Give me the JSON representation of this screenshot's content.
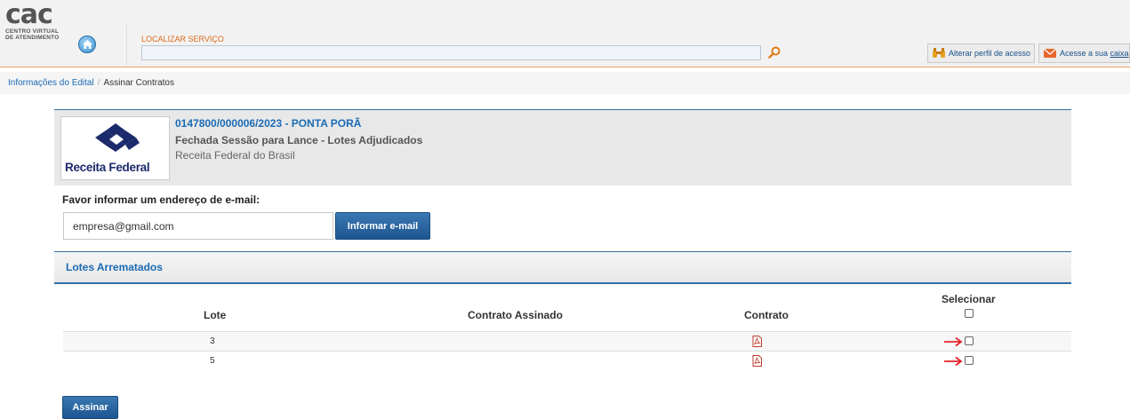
{
  "header": {
    "logo_main": "cac",
    "logo_sub_line1": "CENTRO VIRTUAL",
    "logo_sub_line2": "DE ATENDIMENTO",
    "search_label": "LOCALIZAR SERVIÇO",
    "search_value": "",
    "btn_alterar_perfil": "Alterar perfil de acesso",
    "btn_caixa_prefix": "Acesse a sua",
    "btn_caixa_link": "caixa"
  },
  "breadcrumb": {
    "items": [
      "Informações do Edital",
      "Assinar Contratos"
    ],
    "separator": "/"
  },
  "info": {
    "logo_text": "Receita Federal",
    "title": "0147800/000006/2023 - PONTA PORÃ",
    "status": "Fechada Sessão para Lance - Lotes Adjudicados",
    "org": "Receita Federal do Brasil"
  },
  "email": {
    "label": "Favor informar um endereço de e-mail:",
    "value": "empresa@gmail.com",
    "button": "Informar e-mail"
  },
  "lotes": {
    "section_title": "Lotes Arrematados",
    "columns": [
      "Lote",
      "Contrato Assinado",
      "Contrato",
      "Selecionar"
    ],
    "rows": [
      {
        "lote": "3",
        "contrato_assinado": "",
        "contrato_icon": "pdf-icon",
        "selected": false
      },
      {
        "lote": "5",
        "contrato_assinado": "",
        "contrato_icon": "pdf-icon",
        "selected": false
      }
    ]
  },
  "actions": {
    "assinar": "Assinar"
  },
  "colors": {
    "accent_blue": "#1a6bb5",
    "button_blue": "#1e5590",
    "orange": "#e06a1b",
    "arrow_red": "#e8232a"
  }
}
